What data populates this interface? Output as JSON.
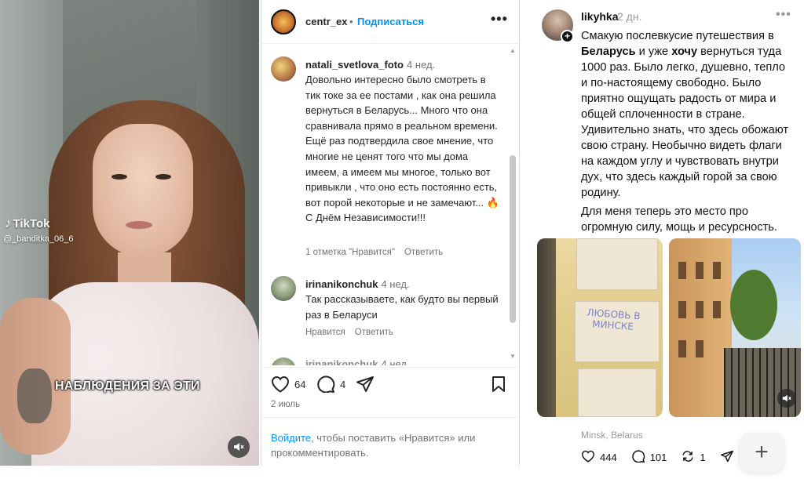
{
  "tiktok": {
    "brand": "TikTok",
    "handle": "@_banditka_06_6",
    "caption": "НАБЛЮДЕНИЯ ЗА ЭТИ",
    "mute_icon": "speaker-muted-icon"
  },
  "instagram": {
    "author": "centr_ex",
    "separator": "•",
    "follow_label": "Подписаться",
    "more_label": "•••",
    "comments": [
      {
        "user": "natali_svetlova_foto",
        "time": "4 нед.",
        "text": "Довольно интересно было смотреть в тик токе за ее постами , как она решила вернуться в Беларусь... Много что она сравнивала прямо в реальном времени. Ещё раз подтвердила свое мнение, что многие не ценят того что мы дома имеем, а имеем мы многое, только вот привыкли , что оно есть постоянно есть, вот порой некоторые и не замечают... 🔥С Днём Независимости!!!",
        "likes_label": "1 отметка \"Нравится\"",
        "reply_label": "Ответить"
      },
      {
        "user": "irinanikonchuk",
        "time": "4 нед.",
        "text": "Так рассказываете, как будто вы первый раз в Беларуси",
        "likes_label": "Нравится",
        "reply_label": "Ответить"
      },
      {
        "user": "irinanikonchuk",
        "time": "4 нед.",
        "text": ""
      }
    ],
    "like_count": "64",
    "comment_count": "4",
    "date": "2 июль",
    "login_link": "Войдите",
    "login_text": ", чтобы поставить «Нравится» или прокомментировать."
  },
  "threads": {
    "user": "likyhka",
    "time": "2 дн.",
    "more_label": "•••",
    "body_parts": {
      "p1": "Смакую послевкусие путешествия в ",
      "b1": "Беларусь",
      "p2": " и уже ",
      "b2": "хочу",
      "p3": " вернуться туда 1000 раз. Было легко, душевно, тепло и по-настоящему свободно. Было приятно ощущать радость от мира и общей сплоченности в стране. Удивительно знать, что здесь обожают свою страну. Необычно видеть флаги на каждом углу и чувствовать внутри дух, что здесь каждый горой за свою родину."
    },
    "body2": "Для меня теперь это место про огромную силу, мощь и ресурсность.",
    "graffiti": "ЛЮБОВЬ В МИНСКЕ",
    "location": "Minsk, Belarus",
    "likes": "444",
    "comments": "101",
    "reposts": "1",
    "fab_label": "+"
  }
}
